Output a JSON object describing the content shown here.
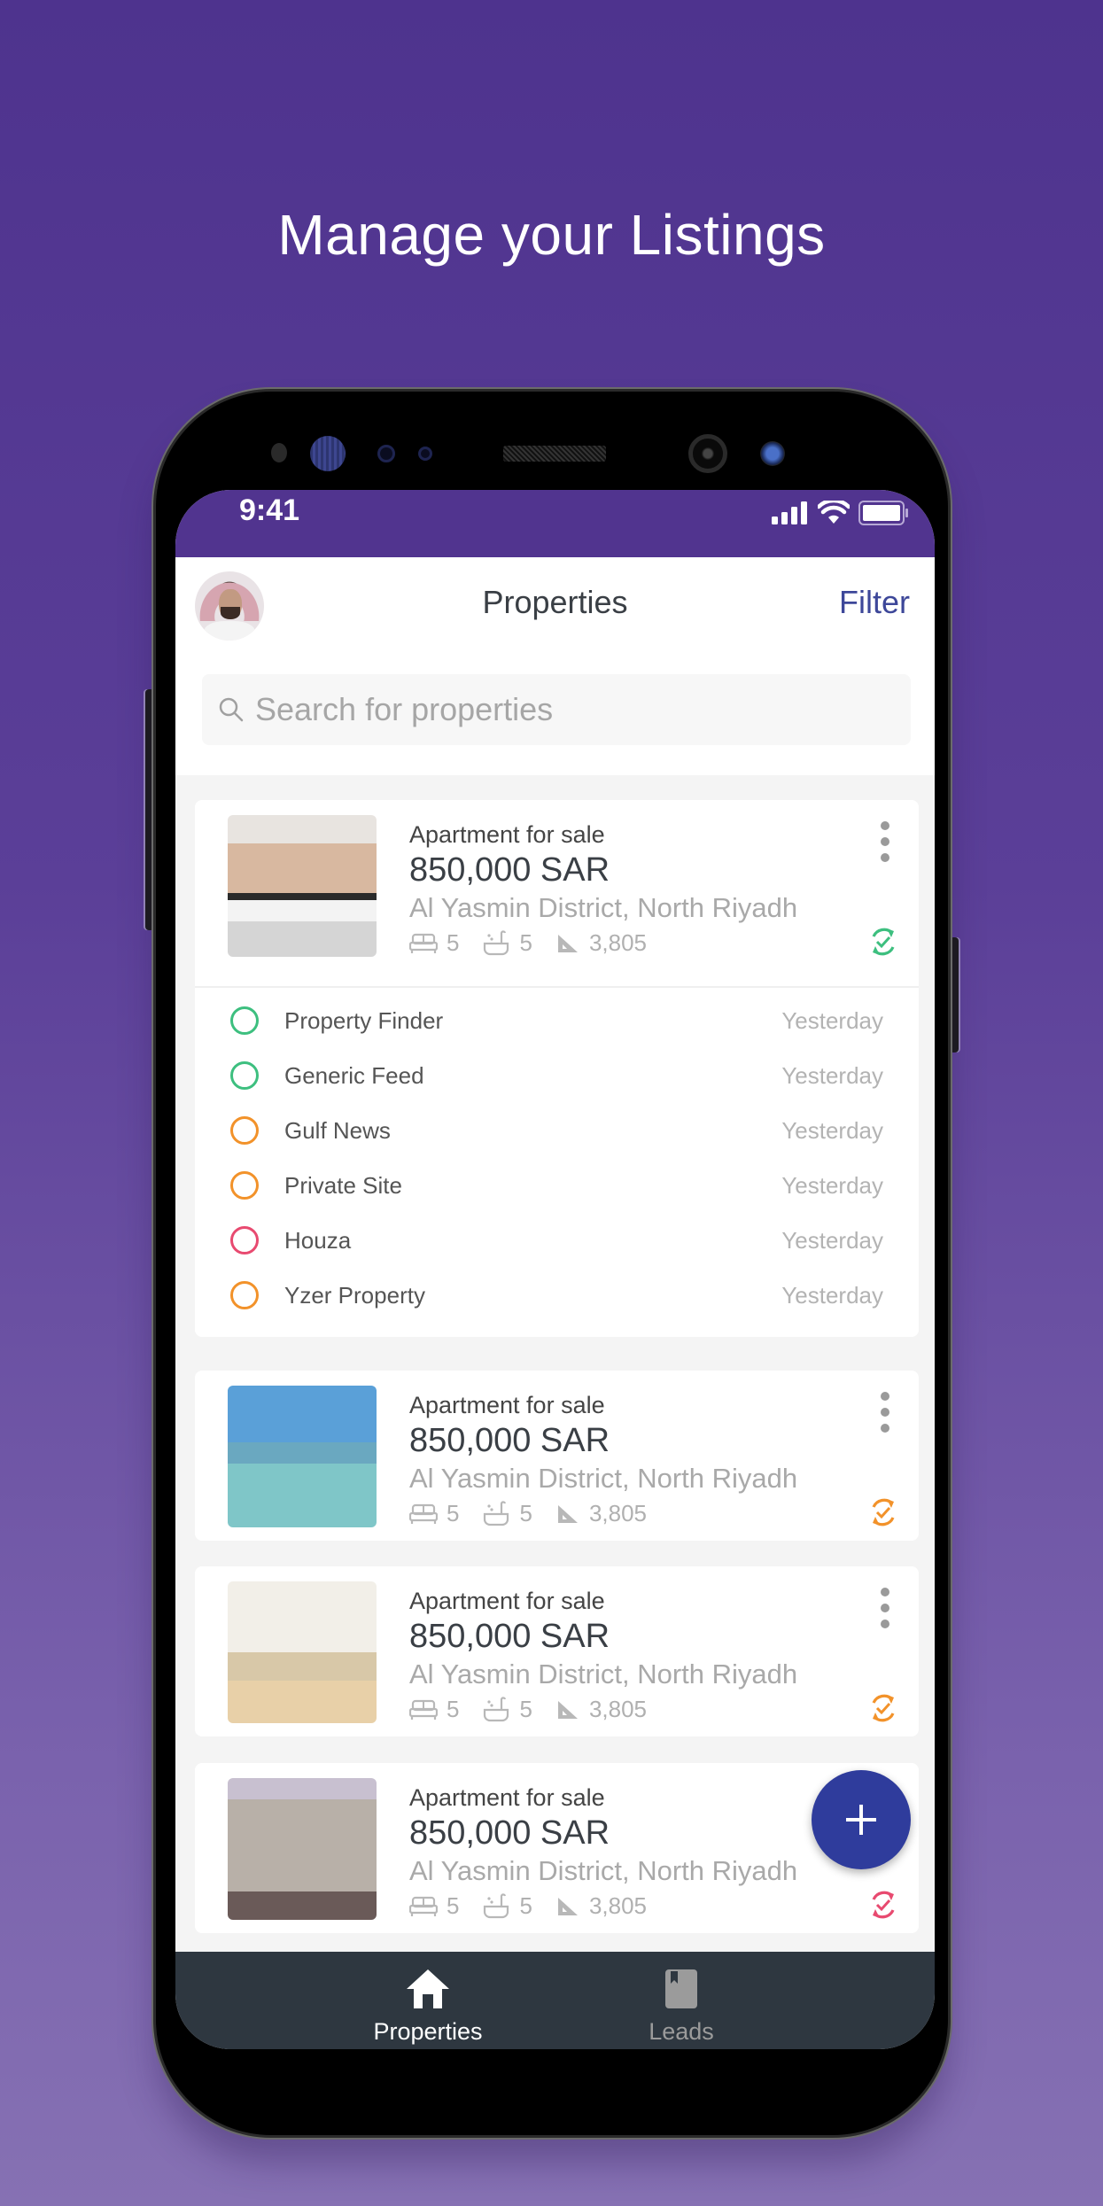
{
  "headline": "Manage your Listings",
  "status_bar": {
    "time": "9:41",
    "signal_icon": "signal-bars-icon",
    "wifi_icon": "wifi-icon",
    "battery_icon": "battery-icon"
  },
  "header": {
    "title": "Properties",
    "filter_label": "Filter",
    "avatar_icon": "user-avatar"
  },
  "search": {
    "placeholder": "Search for properties",
    "value": "",
    "icon": "search-icon"
  },
  "colors": {
    "accent": "#51348f",
    "link": "#3d4799",
    "fab": "#2f3c9c",
    "nav_bg": "#2e3740",
    "status_green": "#3dbf7f",
    "status_orange": "#f2922a",
    "status_red": "#e84a70"
  },
  "listings": [
    {
      "type": "Apartment for sale",
      "price": "850,000 SAR",
      "location": "Al Yasmin District, North Riyadh",
      "beds": "5",
      "baths": "5",
      "area": "3,805",
      "sync_status": "green",
      "expanded": true,
      "portals": [
        {
          "name": "Property Finder",
          "date": "Yesterday",
          "status": "green"
        },
        {
          "name": "Generic Feed",
          "date": "Yesterday",
          "status": "green"
        },
        {
          "name": "Gulf News",
          "date": "Yesterday",
          "status": "orange"
        },
        {
          "name": "Private Site",
          "date": "Yesterday",
          "status": "orange"
        },
        {
          "name": "Houza",
          "date": "Yesterday",
          "status": "red"
        },
        {
          "name": "Yzer Property",
          "date": "Yesterday",
          "status": "orange"
        }
      ]
    },
    {
      "type": "Apartment for sale",
      "price": "850,000 SAR",
      "location": "Al Yasmin District, North Riyadh",
      "beds": "5",
      "baths": "5",
      "area": "3,805",
      "sync_status": "orange"
    },
    {
      "type": "Apartment for sale",
      "price": "850,000 SAR",
      "location": "Al Yasmin District, North Riyadh",
      "beds": "5",
      "baths": "5",
      "area": "3,805",
      "sync_status": "orange"
    },
    {
      "type": "Apartment for sale",
      "price": "850,000 SAR",
      "location": "Al Yasmin District, North Riyadh",
      "beds": "5",
      "baths": "5",
      "area": "3,805",
      "sync_status": "red"
    }
  ],
  "fab": {
    "icon": "plus-icon"
  },
  "bottom_nav": [
    {
      "label": "Properties",
      "icon": "home-icon",
      "active": true
    },
    {
      "label": "Leads",
      "icon": "book-icon",
      "active": false
    }
  ]
}
